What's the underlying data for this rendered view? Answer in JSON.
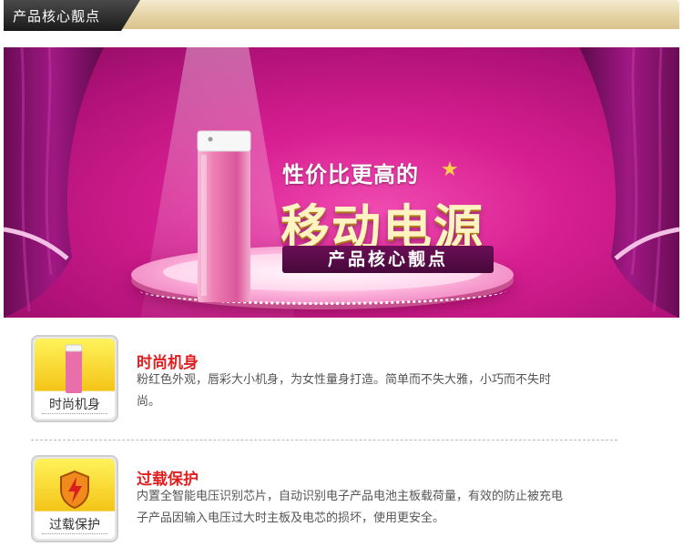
{
  "header": {
    "title": "产品核心靓点"
  },
  "banner": {
    "tagline": "性价比更高的",
    "star": "★",
    "title": "移动电源",
    "subtitle": "产品核心靓点"
  },
  "features": [
    {
      "icon_label": "时尚机身",
      "title": "时尚机身",
      "text": "粉红色外观，唇彩大小机身，为女性量身打造。简单而不失大雅，小巧而不失时尚。"
    },
    {
      "icon_label": "过载保护",
      "title": "过载保护",
      "text": "内置全智能电压识别芯片，自动识别电子产品电池主板载荷量，有效的防止被充电子产品因输入电压过大时主板及电芯的损坏，使用更安全。"
    }
  ],
  "colors": {
    "accent_red": "#e02020",
    "banner_pink": "#d81f92",
    "gold": "#e6d3a4"
  },
  "icons": [
    "power-bank-icon",
    "shield-lightning-icon",
    "star-icon"
  ]
}
